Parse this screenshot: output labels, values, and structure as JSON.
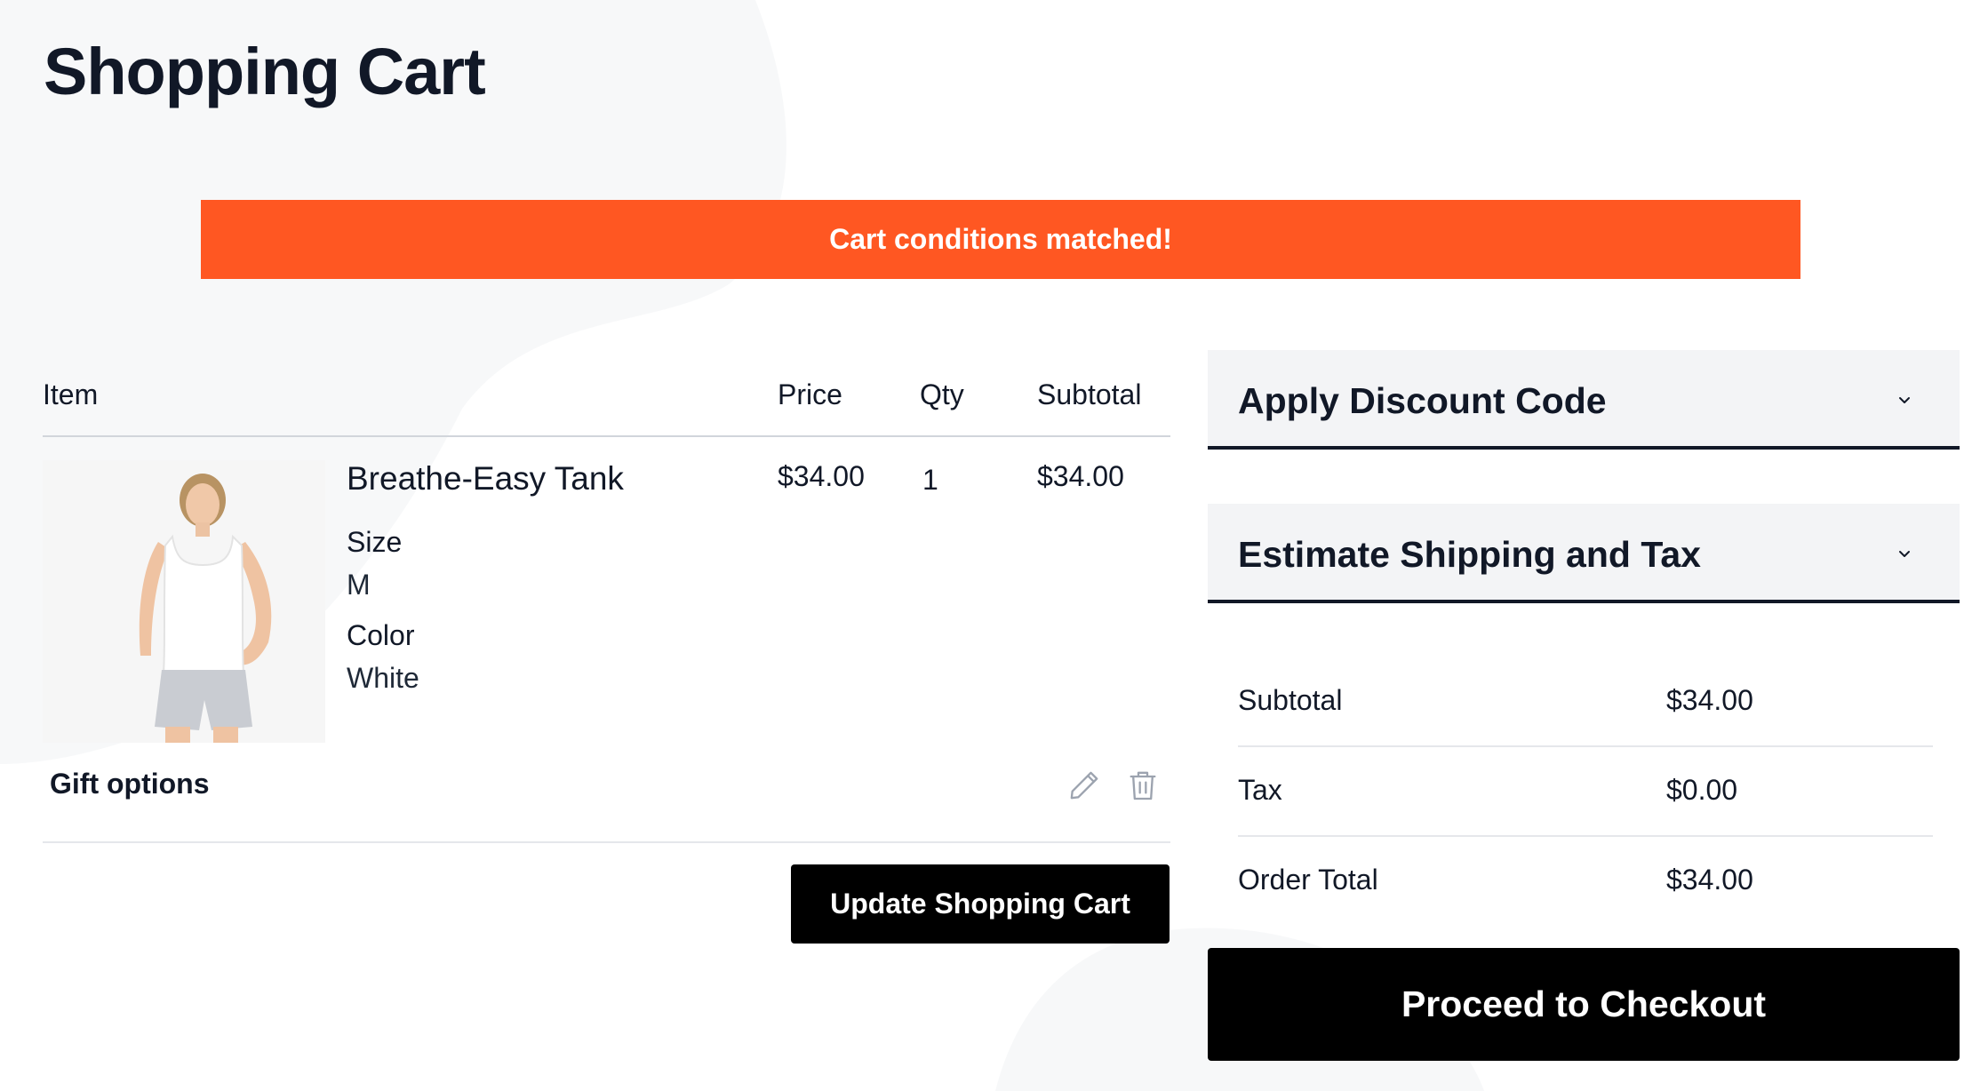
{
  "page": {
    "title": "Shopping Cart"
  },
  "banner": {
    "message": "Cart conditions matched!",
    "color": "#ff5722"
  },
  "cart": {
    "columns": {
      "item": "Item",
      "price": "Price",
      "qty": "Qty",
      "subtotal": "Subtotal"
    },
    "items": [
      {
        "name": "Breathe-Easy Tank",
        "image_icon": "product-photo-tank-top",
        "options": [
          {
            "label": "Size",
            "value": "M"
          },
          {
            "label": "Color",
            "value": "White"
          }
        ],
        "price": "$34.00",
        "qty": "1",
        "subtotal": "$34.00",
        "gift_options_label": "Gift options",
        "actions": {
          "edit_icon": "pencil-icon",
          "delete_icon": "trash-icon"
        }
      }
    ],
    "update_button_label": "Update Shopping Cart"
  },
  "summary": {
    "discount_title": "Apply Discount Code",
    "shipping_title": "Estimate Shipping and Tax",
    "totals": [
      {
        "label": "Subtotal",
        "value": "$34.00"
      },
      {
        "label": "Tax",
        "value": "$0.00"
      },
      {
        "label": "Order Total",
        "value": "$34.00"
      }
    ],
    "checkout_button_label": "Proceed to Checkout"
  },
  "colors": {
    "primary_button": "#000000",
    "accent": "#ff5722",
    "text": "#111827"
  }
}
